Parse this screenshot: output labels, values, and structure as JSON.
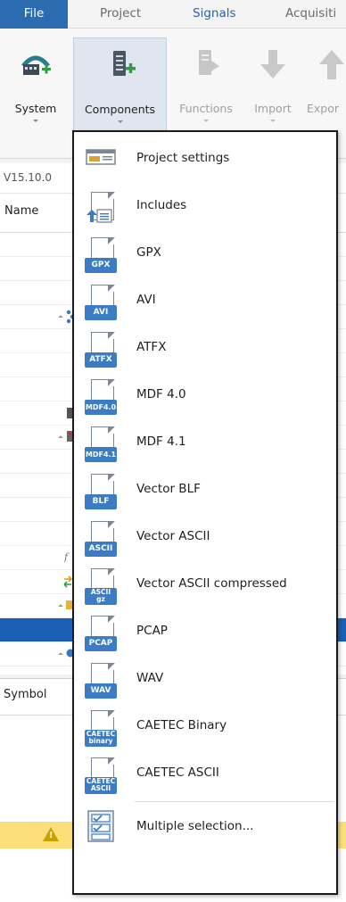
{
  "tabs": [
    {
      "label": "File"
    },
    {
      "label": "Project"
    },
    {
      "label": "Signals"
    },
    {
      "label": "Acquisiti"
    }
  ],
  "ribbon": {
    "buttons": [
      {
        "label": "System",
        "enabled": true
      },
      {
        "label": "Components",
        "enabled": true,
        "active": true
      },
      {
        "label": "Functions",
        "enabled": false
      },
      {
        "label": "Import",
        "enabled": false
      },
      {
        "label": "Expor",
        "enabled": false
      }
    ]
  },
  "pathbar": {
    "version_text": "V15.10.0"
  },
  "tree": {
    "column_header": "Name"
  },
  "lower_panel": {
    "column_header": "Symbol",
    "warning_icon": "warning-icon"
  },
  "menu": {
    "items": [
      {
        "label": "Project settings",
        "icon": "project-settings-icon"
      },
      {
        "label": "Includes",
        "icon": "includes-icon"
      },
      {
        "label": "GPX",
        "icon": "gpx-file-icon",
        "badge": "GPX"
      },
      {
        "label": "AVI",
        "icon": "avi-file-icon",
        "badge": "AVI"
      },
      {
        "label": "ATFX",
        "icon": "atfx-file-icon",
        "badge": "ATFX"
      },
      {
        "label": "MDF 4.0",
        "icon": "mdf40-file-icon",
        "badge": "MDF4.0"
      },
      {
        "label": "MDF 4.1",
        "icon": "mdf41-file-icon",
        "badge": "MDF4.1"
      },
      {
        "label": "Vector BLF",
        "icon": "blf-file-icon",
        "badge": "BLF"
      },
      {
        "label": "Vector ASCII",
        "icon": "ascii-file-icon",
        "badge": "ASCII"
      },
      {
        "label": "Vector ASCII compressed",
        "icon": "ascii-gz-file-icon",
        "badge": "ASCII",
        "badge2": "gz"
      },
      {
        "label": "PCAP",
        "icon": "pcap-file-icon",
        "badge": "PCAP"
      },
      {
        "label": "WAV",
        "icon": "wav-file-icon",
        "badge": "WAV"
      },
      {
        "label": "CAETEC Binary",
        "icon": "caetec-binary-file-icon",
        "badge": "CAETEC",
        "badge2": "binary"
      },
      {
        "label": "CAETEC ASCII",
        "icon": "caetec-ascii-file-icon",
        "badge": "CAETEC",
        "badge2": "ASCII"
      },
      {
        "label": "Multiple selection...",
        "icon": "multiple-selection-icon"
      }
    ]
  }
}
